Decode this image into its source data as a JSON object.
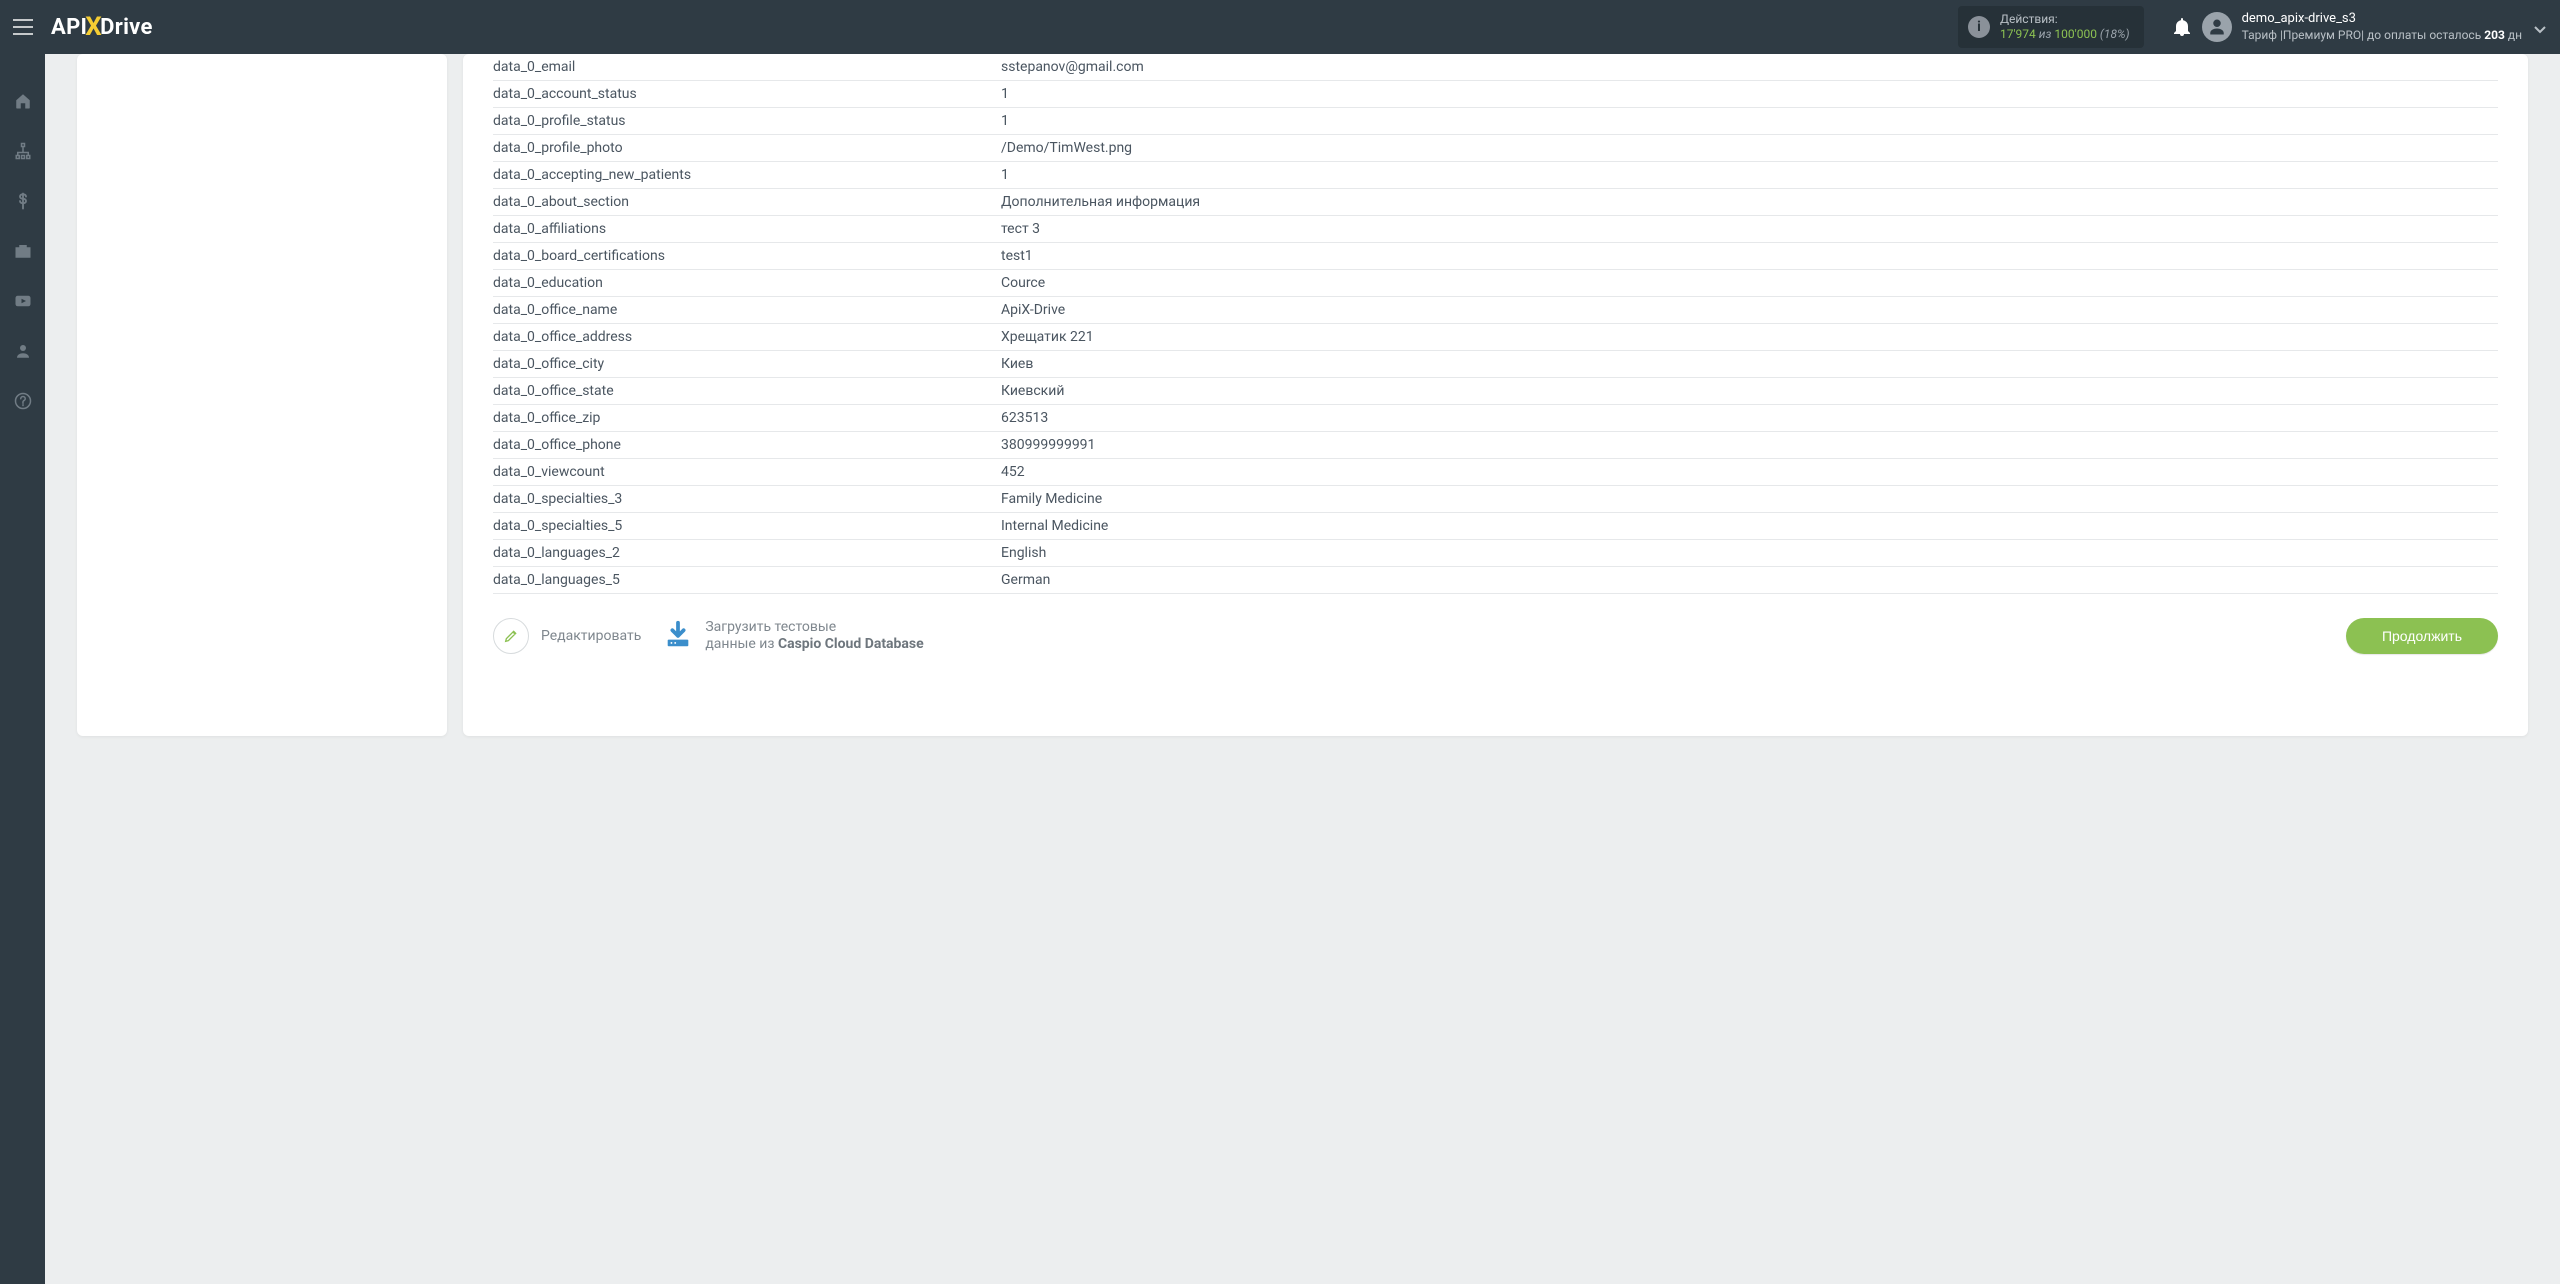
{
  "brand": {
    "api": "API",
    "x": "X",
    "drive": "Drive"
  },
  "header": {
    "actions_label": "Действия:",
    "used": "17'974",
    "iz": "из",
    "total": "100'000",
    "pct": "(18%)"
  },
  "user": {
    "name": "demo_apix-drive_s3",
    "tariff_pre": "Тариф |Премиум PRO| до оплаты осталось ",
    "days": "203",
    "dn": " дн"
  },
  "rows": [
    {
      "k": "data_0_email",
      "v": "sstepanov@gmail.com"
    },
    {
      "k": "data_0_account_status",
      "v": "1"
    },
    {
      "k": "data_0_profile_status",
      "v": "1"
    },
    {
      "k": "data_0_profile_photo",
      "v": "/Demo/TimWest.png"
    },
    {
      "k": "data_0_accepting_new_patients",
      "v": "1"
    },
    {
      "k": "data_0_about_section",
      "v": "Дополнительная информация"
    },
    {
      "k": "data_0_affiliations",
      "v": "тест 3"
    },
    {
      "k": "data_0_board_certifications",
      "v": "test1"
    },
    {
      "k": "data_0_education",
      "v": "Cource"
    },
    {
      "k": "data_0_office_name",
      "v": "ApiX-Drive"
    },
    {
      "k": "data_0_office_address",
      "v": "Хрещатик 221"
    },
    {
      "k": "data_0_office_city",
      "v": "Киев"
    },
    {
      "k": "data_0_office_state",
      "v": "Киевский"
    },
    {
      "k": "data_0_office_zip",
      "v": "623513"
    },
    {
      "k": "data_0_office_phone",
      "v": "380999999991"
    },
    {
      "k": "data_0_viewcount",
      "v": "452"
    },
    {
      "k": "data_0_specialties_3",
      "v": "Family Medicine"
    },
    {
      "k": "data_0_specialties_5",
      "v": "Internal Medicine"
    },
    {
      "k": "data_0_languages_2",
      "v": "English"
    },
    {
      "k": "data_0_languages_5",
      "v": "German"
    }
  ],
  "buttons": {
    "edit": "Редактировать",
    "load_l1": "Загрузить тестовые",
    "load_l2_pre": "данные из ",
    "load_l2_b": "Caspio Cloud Database",
    "continue": "Продолжить"
  }
}
